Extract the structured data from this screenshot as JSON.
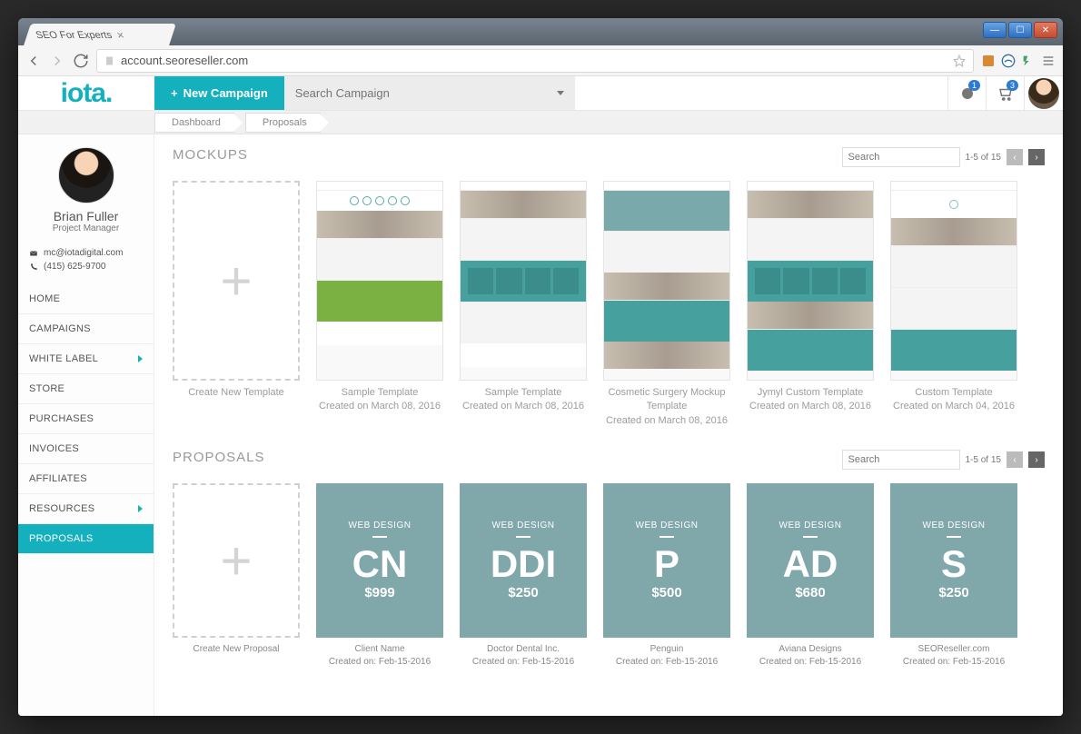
{
  "browser": {
    "tab_title": "SEO For Experts",
    "url": "account.seoreseller.com"
  },
  "header": {
    "logo": "iota.",
    "new_campaign": "New Campaign",
    "search_placeholder": "Search Campaign",
    "notifications_badge": "1",
    "cart_badge": "3"
  },
  "breadcrumbs": [
    "Dashboard",
    "Proposals"
  ],
  "user": {
    "name": "Brian Fuller",
    "role": "Project Manager",
    "email": "mc@iotadigital.com",
    "phone": "(415) 625-9700"
  },
  "nav": {
    "items": [
      {
        "label": "HOME"
      },
      {
        "label": "CAMPAIGNS"
      },
      {
        "label": "WHITE LABEL",
        "arrow": true
      },
      {
        "label": "STORE"
      },
      {
        "label": "PURCHASES"
      },
      {
        "label": "INVOICES"
      },
      {
        "label": "AFFILIATES"
      },
      {
        "label": "RESOURCES",
        "arrow": true
      },
      {
        "label": "PROPOSALS",
        "active": true
      }
    ]
  },
  "mockups": {
    "title": "MOCKUPS",
    "search_placeholder": "Search",
    "page_label": "1-5 of 15",
    "create_label": "Create New Template",
    "items": [
      {
        "title": "Sample Template",
        "meta": "Created on March 08, 2016"
      },
      {
        "title": "Sample Template",
        "meta": "Created on March 08, 2016"
      },
      {
        "title": "Cosmetic Surgery Mockup Template",
        "meta": "Created on March 08, 2016"
      },
      {
        "title": "Jymyl Custom Template",
        "meta": "Created on March 08, 2016"
      },
      {
        "title": "Custom Template",
        "meta": "Created on March 04, 2016"
      }
    ]
  },
  "proposals": {
    "title": "PROPOSALS",
    "search_placeholder": "Search",
    "page_label": "1-5 of 15",
    "create_label": "Create New Proposal",
    "items": [
      {
        "category": "WEB DESIGN",
        "code": "CN",
        "price": "$999",
        "client": "Client Name",
        "meta": "Created on: Feb-15-2016"
      },
      {
        "category": "WEB DESIGN",
        "code": "DDI",
        "price": "$250",
        "client": "Doctor Dental Inc.",
        "meta": "Created on: Feb-15-2016"
      },
      {
        "category": "WEB DESIGN",
        "code": "P",
        "price": "$500",
        "client": "Penguin",
        "meta": "Created on: Feb-15-2016"
      },
      {
        "category": "WEB DESIGN",
        "code": "AD",
        "price": "$680",
        "client": "Aviana Designs",
        "meta": "Created on: Feb-15-2016"
      },
      {
        "category": "WEB DESIGN",
        "code": "S",
        "price": "$250",
        "client": "SEOReseller.com",
        "meta": "Created on: Feb-15-2016"
      }
    ]
  }
}
